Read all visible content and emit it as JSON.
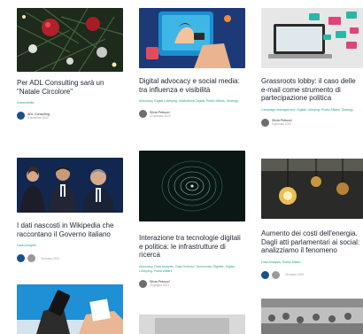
{
  "columns": [
    {
      "cards": [
        {
          "title": "Per ADL Consulting sarà un \"Natale Circolore\"",
          "tags": "Sostenibilità",
          "author": "ADL Consulting",
          "date": "9 dicembre 2022",
          "image": "christmas-ornaments-thumbnail"
        },
        {
          "title": "I dati nascosti in Wikipedia che raccontano il Governo italiano",
          "tags": "Data Analysis",
          "author": "",
          "date": "18 marzo 2021",
          "image": "politicians-portrait-thumbnail"
        },
        {
          "title": "",
          "tags": "",
          "author": "",
          "date": "",
          "image": "voting-ballot-box-thumbnail"
        }
      ]
    },
    {
      "cards": [
        {
          "title": "Digital advocacy e social media: tra influenza e visibilità",
          "tags": "Advocacy, Digital Lobbying, Institutional Digital, Public Affairs, Strategy",
          "author": "Silvia Petruzzi",
          "date": "12 gennaio 2022",
          "image": "smartphone-social-thumbnail"
        },
        {
          "title": "Interazione tra tecnologie digitali e politica: le infrastrutture di ricerca",
          "tags": "Advocacy, Data Analysis, Data Science, Democratic Digitale, Digital Lobbying, Public Affairs",
          "author": "Silvia Petruzzi",
          "date": "25 giugno 2021",
          "image": "data-spiral-thumbnail"
        },
        {
          "title": "",
          "tags": "",
          "author": "",
          "date": "",
          "image": "laptop-thumbnail"
        }
      ]
    },
    {
      "cards": [
        {
          "title": "Grassroots lobby: il caso delle e-mail come strumento di partecipazione politica",
          "tags": "Campaign Management, Digital Lobbying, Public Affairs, Strategy",
          "author": "Silvia Petruzzi",
          "date": "5 gennaio 2022",
          "image": "laptop-email-thumbnail"
        },
        {
          "title": "Aumento dei costi dell'energia. Dagli atti parlamentari ai social: analizziamo il fenomeno",
          "tags": "Data Analysis, Public Affairs",
          "author": "",
          "date": "15 marzo 2022",
          "image": "light-bulbs-thumbnail"
        },
        {
          "title": "",
          "tags": "",
          "author": "",
          "date": "",
          "image": "parliament-crowd-thumbnail"
        }
      ]
    }
  ],
  "colors": {
    "accent": "#2fa38f",
    "title": "#1e2530",
    "meta": "#999999"
  }
}
